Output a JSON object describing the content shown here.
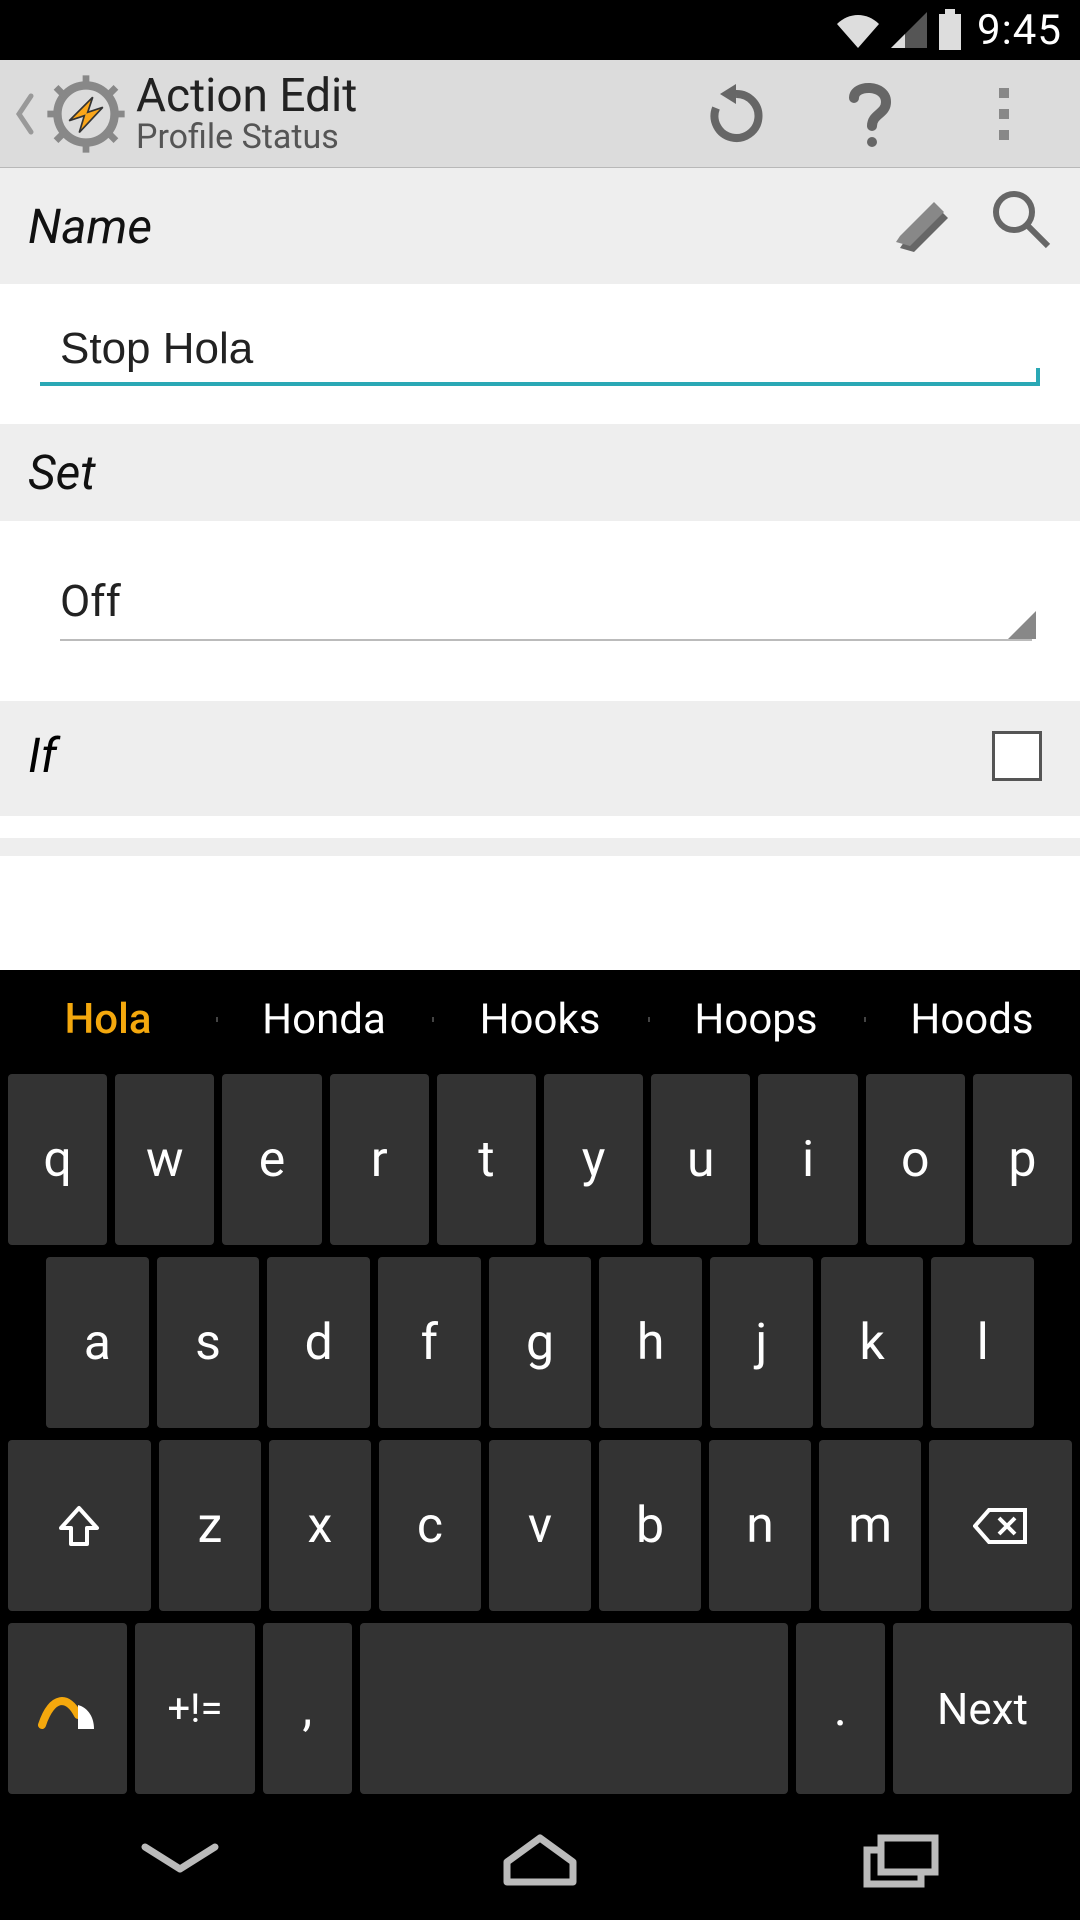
{
  "status": {
    "time": "9:45"
  },
  "actionbar": {
    "title": "Action Edit",
    "subtitle": "Profile Status"
  },
  "sections": {
    "name_label": "Name",
    "set_label": "Set",
    "if_label": "If"
  },
  "fields": {
    "name_value": "Stop Hola",
    "set_value": "Off",
    "if_checked": false
  },
  "keyboard": {
    "suggestions": [
      "Hola",
      "Honda",
      "Hooks",
      "Hoops",
      "Hoods"
    ],
    "row1": [
      "q",
      "w",
      "e",
      "r",
      "t",
      "y",
      "u",
      "i",
      "o",
      "p"
    ],
    "row2": [
      "a",
      "s",
      "d",
      "f",
      "g",
      "h",
      "j",
      "k",
      "l"
    ],
    "row3": [
      "z",
      "x",
      "c",
      "v",
      "b",
      "n",
      "m"
    ],
    "sym": "+!=",
    "comma": ",",
    "period": ".",
    "next": "Next"
  }
}
